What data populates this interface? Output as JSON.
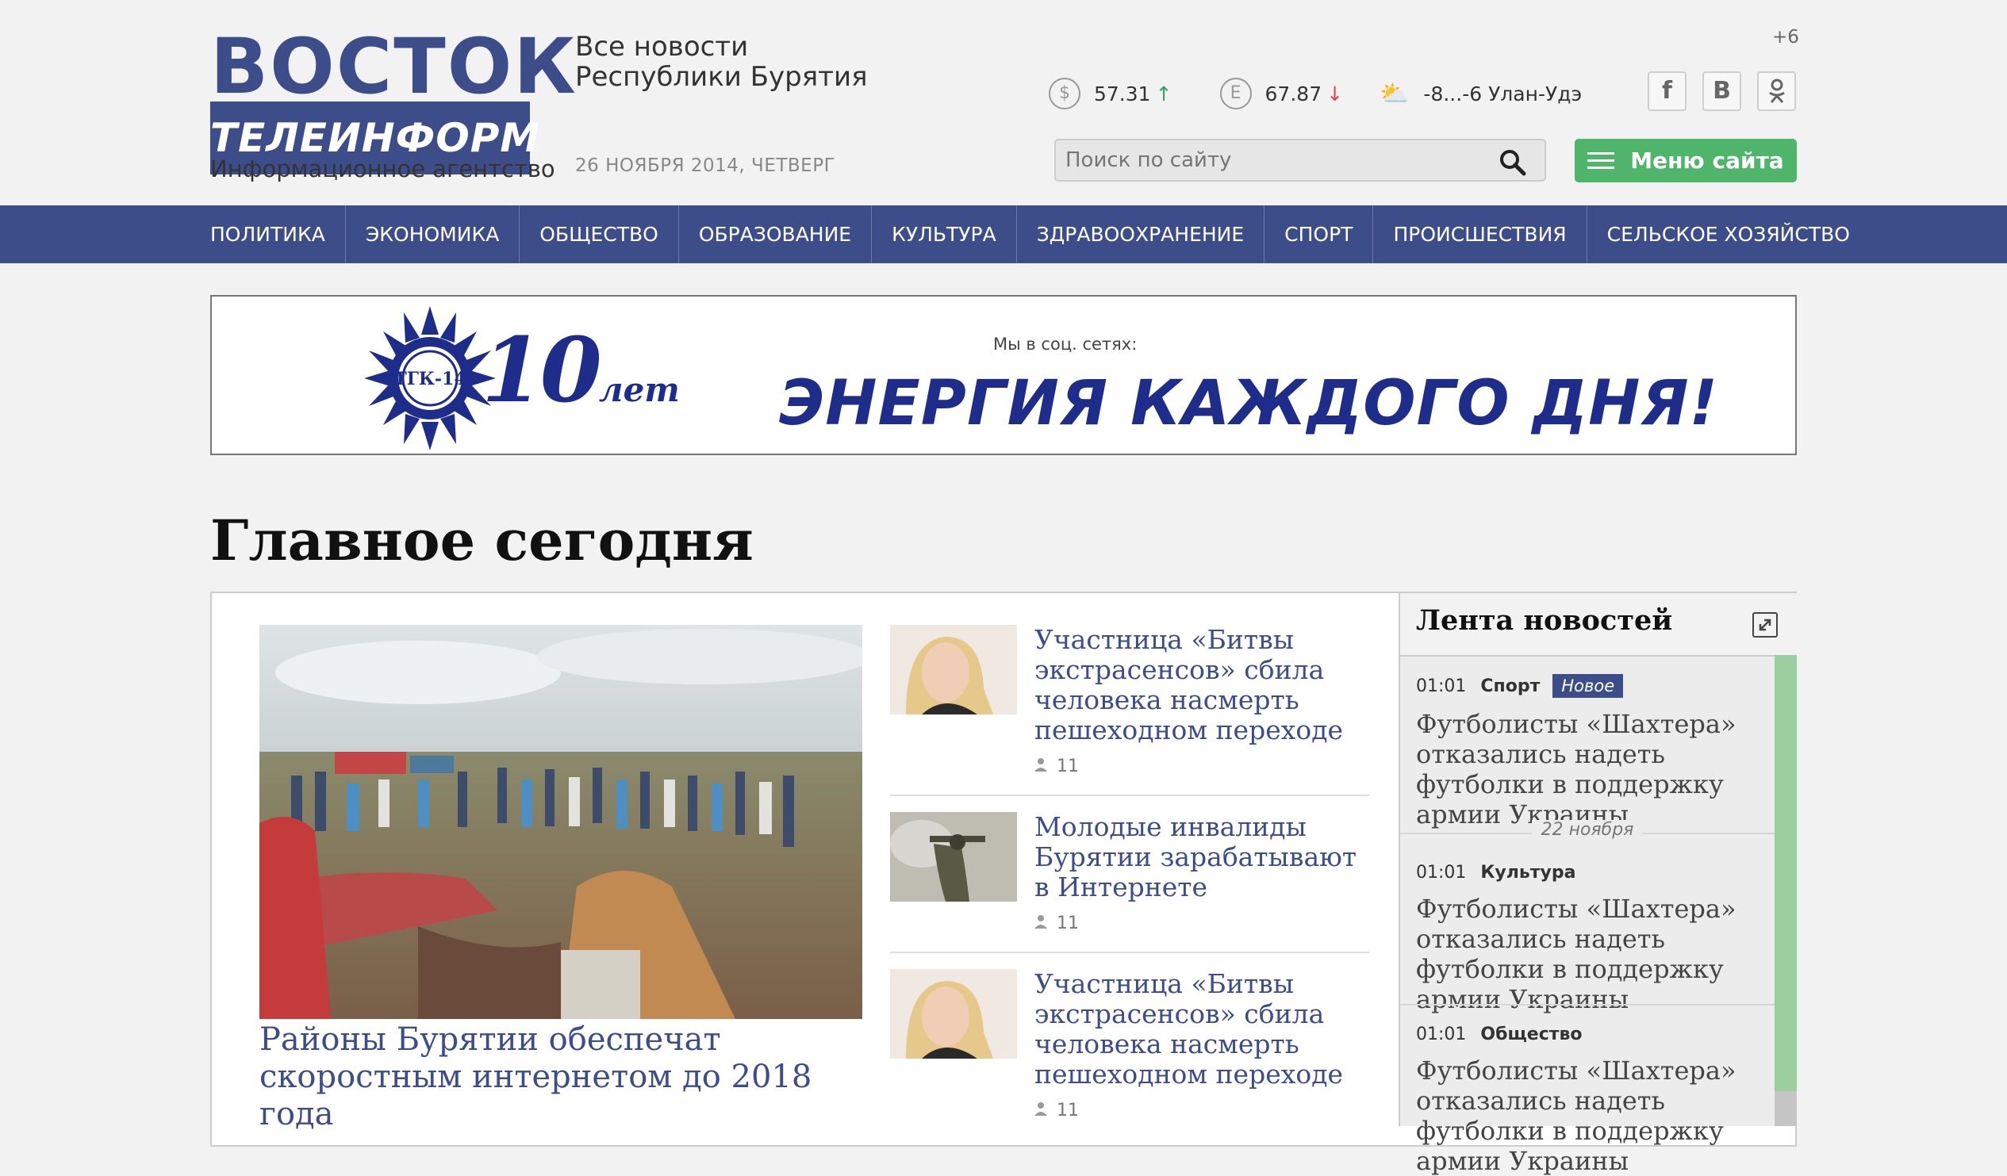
{
  "header": {
    "logo_top": "ВОСТОК",
    "logo_band": "ТЕЛЕИНФОРМ",
    "logo_sub": "Информационное агентство",
    "tagline_line1": "Все новости",
    "tagline_line2": "Республики Бурятия",
    "date": "26 НОЯБРЯ 2014, ЧЕТВЕРГ",
    "usd_symbol": "$",
    "usd_rate": "57.31",
    "eur_symbol": "E",
    "eur_rate": "67.87",
    "weather": "-8...-6 Улан-Удэ",
    "timezone": "+6",
    "social": [
      "f",
      "B",
      "ok"
    ],
    "search_placeholder": "Поиск по сайту",
    "menu_label": "Меню сайта"
  },
  "nav": {
    "items": [
      "ПОЛИТИКА",
      "ЭКОНОМИКА",
      "ОБЩЕСТВО",
      "ОБРАЗОВАНИЕ",
      "КУЛЬТУРА",
      "ЗДРАВООХРАНЕНИЕ",
      "СПОРТ",
      "ПРОИСШЕСТВИЯ",
      "СЕЛЬСКОЕ ХОЗЯЙСТВО"
    ]
  },
  "banner": {
    "logo_text": "ТГК-14",
    "years": "10",
    "years_suffix": "лет",
    "social_caption": "Мы в соц. сетях:",
    "slogan": "ЭНЕРГИЯ КАЖДОГО ДНЯ!"
  },
  "main": {
    "section_title": "Главное сегодня",
    "lead_title": "Районы Бурятии обеспечат скоростным интернетом до 2018 года",
    "news": [
      {
        "title": "Участница «Битвы экстрасенсов» сбила человека насмерть пешеходном переходе",
        "views": "11"
      },
      {
        "title": "Молодые инвалиды Бурятии зарабатывают в Интернете",
        "views": "11"
      },
      {
        "title": "Участница «Битвы экстрасенсов» сбила человека насмерть пешеходном переходе",
        "views": "11"
      }
    ]
  },
  "feed": {
    "title": "Лента новостей",
    "items": [
      {
        "time": "01:01",
        "category": "Спорт",
        "badge": "Новое",
        "title": "Футболисты «Шахтера» отказались надеть футболки в поддержку армии Украины"
      },
      {
        "time": "01:01",
        "category": "Культура",
        "title": "Футболисты «Шахтера» отказались надеть футболки в поддержку армии Украины"
      },
      {
        "time": "01:01",
        "category": "Общество",
        "title": "Футболисты «Шахтера» отказались надеть футболки в поддержку армии Украины"
      }
    ],
    "date_divider": "22 ноября"
  },
  "colors": {
    "brand_blue": "#3d4d8a",
    "accent_green": "#4fb56b",
    "rate_up": "#2da55a",
    "rate_down": "#e34545"
  }
}
